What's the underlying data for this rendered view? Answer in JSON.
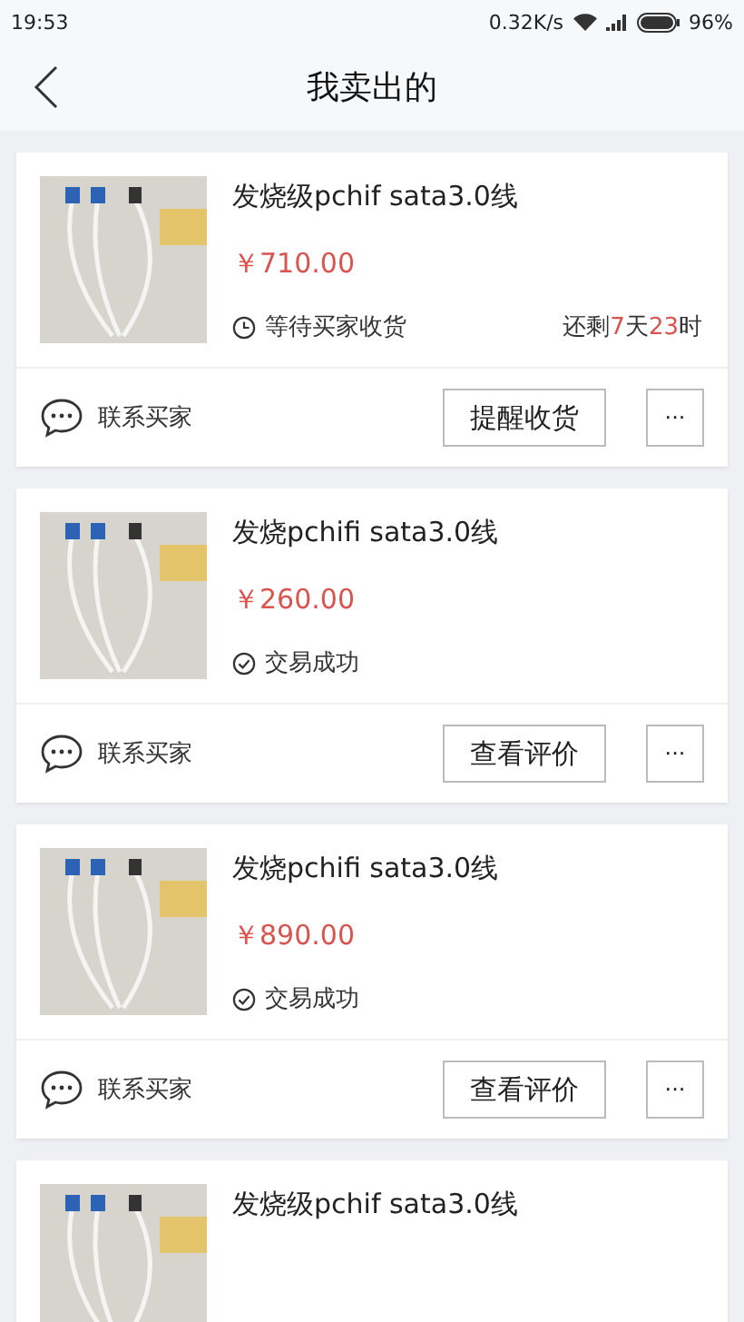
{
  "status_bar": {
    "time": "19:53",
    "speed": "0.32K/s",
    "battery": "96%"
  },
  "header": {
    "title": "我卖出的"
  },
  "orders": [
    {
      "title": "发烧级pchif sata3.0线",
      "price": "￥710.00",
      "status": {
        "kind": "waiting",
        "text": "等待买家收货"
      },
      "remaining": [
        {
          "text": "还剩",
          "highlight": false
        },
        {
          "text": "7",
          "highlight": true
        },
        {
          "text": "天",
          "highlight": false
        },
        {
          "text": "23",
          "highlight": true
        },
        {
          "text": "时",
          "highlight": false
        }
      ],
      "contact": "联系买家",
      "action": "提醒收货",
      "more": "···"
    },
    {
      "title": "发烧pchifi sata3.0线",
      "price": "￥260.00",
      "status": {
        "kind": "done",
        "text": "交易成功"
      },
      "contact": "联系买家",
      "action": "查看评价",
      "more": "···"
    },
    {
      "title": "发烧pchifi sata3.0线",
      "price": "￥890.00",
      "status": {
        "kind": "done",
        "text": "交易成功"
      },
      "contact": "联系买家",
      "action": "查看评价",
      "more": "···"
    },
    {
      "title": "发烧级pchif sata3.0线"
    }
  ]
}
